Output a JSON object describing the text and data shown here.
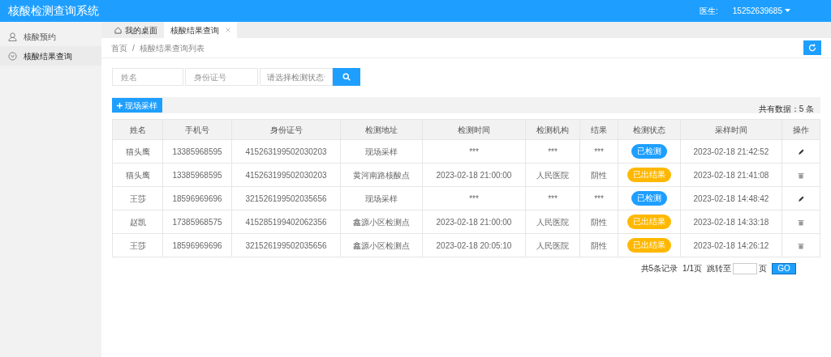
{
  "header": {
    "title": "核酸检测查询系统",
    "user_label": "医生:",
    "user": "15252639685"
  },
  "sidebar": {
    "items": [
      {
        "label": "核酸预约",
        "selected": false
      },
      {
        "label": "核酸结果查询",
        "selected": true
      }
    ]
  },
  "tabs": [
    {
      "label": "我的桌面",
      "selected": false
    },
    {
      "label": "核酸结果查询",
      "selected": true
    }
  ],
  "breadcrumb": {
    "separator": "/",
    "items": [
      "首页",
      "核酸结果查询列表"
    ]
  },
  "search": {
    "name_placeholder": "姓名",
    "id_placeholder": "身份证号",
    "status_placeholder": "请选择检测状态"
  },
  "toolbar": {
    "add_button": "现场采样",
    "total": "共有数据：5 条"
  },
  "table": {
    "columns": [
      "姓名",
      "手机号",
      "身份证号",
      "检测地址",
      "检测时间",
      "检测机构",
      "结果",
      "检测状态",
      "采样时间",
      "操作"
    ],
    "rows": [
      {
        "cells": [
          "猫头鹰",
          "13385968595",
          "415263199502030203",
          "现场采样",
          "***",
          "***",
          "***"
        ],
        "status": "已检测",
        "kind": "tested",
        "sample_time": "2023-02-18 21:42:52"
      },
      {
        "cells": [
          "猫头鹰",
          "13385968595",
          "415263199502030203",
          "黄河南路核酸点",
          "2023-02-18 21:00:00",
          "人民医院",
          "阴性"
        ],
        "status": "已出结果",
        "kind": "result",
        "sample_time": "2023-02-18 21:41:08"
      },
      {
        "cells": [
          "王莎",
          "18596969696",
          "321526199502035656",
          "现场采样",
          "***",
          "***",
          "***"
        ],
        "status": "已检测",
        "kind": "tested",
        "sample_time": "2023-02-18 14:48:42"
      },
      {
        "cells": [
          "赵凯",
          "17385968575",
          "415285199402062356",
          "鑫源小区检测点",
          "2023-02-18 21:00:00",
          "人民医院",
          "阴性"
        ],
        "status": "已出结果",
        "kind": "result",
        "sample_time": "2023-02-18 14:33:18"
      },
      {
        "cells": [
          "王莎",
          "18596969696",
          "321526199502035656",
          "鑫源小区检测点",
          "2023-02-18 20:05:10",
          "人民医院",
          "阴性"
        ],
        "status": "已出结果",
        "kind": "result",
        "sample_time": "2023-02-18 14:26:12"
      }
    ]
  },
  "pager": {
    "records": "共5条记录",
    "pages": "1/1页",
    "jump_label": "跳转至",
    "page_unit": "页",
    "go": "GO"
  }
}
